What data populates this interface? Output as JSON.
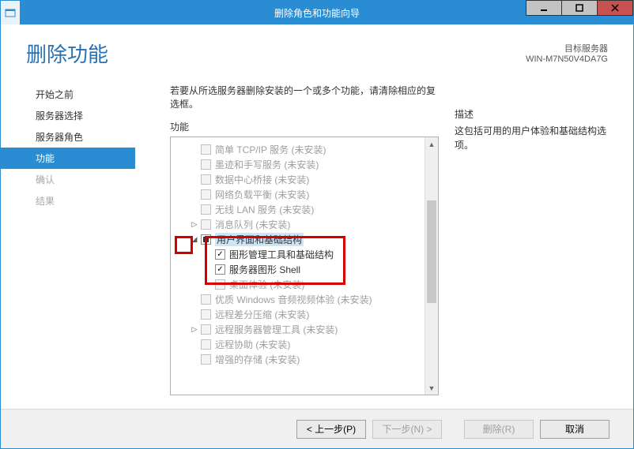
{
  "window": {
    "title": "删除角色和功能向导",
    "target_label": "目标服务器",
    "target_name": "WIN-M7N50V4DA7G"
  },
  "page_title": "删除功能",
  "sidebar": {
    "steps": [
      {
        "label": "开始之前",
        "state": "normal"
      },
      {
        "label": "服务器选择",
        "state": "normal"
      },
      {
        "label": "服务器角色",
        "state": "normal"
      },
      {
        "label": "功能",
        "state": "selected"
      },
      {
        "label": "确认",
        "state": "disabled"
      },
      {
        "label": "结果",
        "state": "disabled"
      }
    ]
  },
  "intro": "若要从所选服务器删除安装的一个或多个功能，请清除相应的复选框。",
  "labels": {
    "features": "功能",
    "description": "描述"
  },
  "description": "这包括可用的用户体验和基础结构选项。",
  "tree": [
    {
      "indent": 1,
      "checkbox": "disabled",
      "label": "简单 TCP/IP 服务 (未安装)",
      "state": "disabled"
    },
    {
      "indent": 1,
      "checkbox": "disabled",
      "label": "墨迹和手写服务 (未安装)",
      "state": "disabled"
    },
    {
      "indent": 1,
      "checkbox": "disabled",
      "label": "数据中心桥接 (未安装)",
      "state": "disabled"
    },
    {
      "indent": 1,
      "checkbox": "disabled",
      "label": "网络负载平衡 (未安装)",
      "state": "disabled"
    },
    {
      "indent": 1,
      "checkbox": "disabled",
      "label": "无线 LAN 服务 (未安装)",
      "state": "disabled"
    },
    {
      "indent": 1,
      "expander": "collapsed",
      "checkbox": "disabled",
      "label": "消息队列 (未安装)",
      "state": "disabled"
    },
    {
      "indent": 1,
      "expander": "expanded",
      "checkbox": "partial",
      "label": "用户界面和基础结构",
      "selected": true
    },
    {
      "indent": 2,
      "checkbox": "checked",
      "label": "图形管理工具和基础结构"
    },
    {
      "indent": 2,
      "checkbox": "checked",
      "label": "服务器图形 Shell"
    },
    {
      "indent": 2,
      "checkbox": "disabled",
      "label": "桌面体验 (未安装)",
      "state": "disabled"
    },
    {
      "indent": 1,
      "checkbox": "disabled",
      "label": "优质 Windows 音频视频体验 (未安装)",
      "state": "disabled"
    },
    {
      "indent": 1,
      "checkbox": "disabled",
      "label": "远程差分压缩 (未安装)",
      "state": "disabled"
    },
    {
      "indent": 1,
      "expander": "collapsed",
      "checkbox": "disabled",
      "label": "远程服务器管理工具 (未安装)",
      "state": "disabled"
    },
    {
      "indent": 1,
      "checkbox": "disabled",
      "label": "远程协助 (未安装)",
      "state": "disabled"
    },
    {
      "indent": 1,
      "checkbox": "disabled",
      "label": "增强的存储 (未安装)",
      "state": "disabled"
    }
  ],
  "buttons": {
    "prev": "< 上一步(P)",
    "next": "下一步(N) >",
    "remove": "删除(R)",
    "cancel": "取消"
  }
}
